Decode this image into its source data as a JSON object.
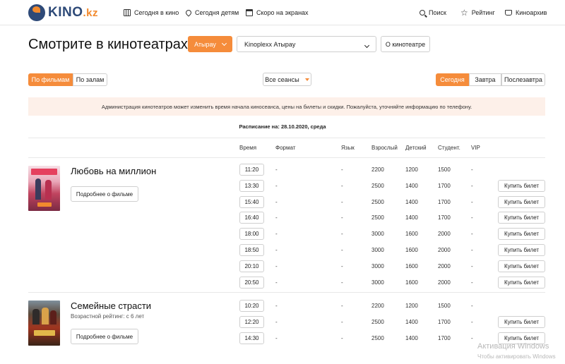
{
  "header": {
    "logo_main": "KINO",
    "logo_suffix": ".kz",
    "nav": [
      {
        "label": "Сегодня в кино",
        "icon": "film-icon"
      },
      {
        "label": "Сегодня детям",
        "icon": "location-pin-icon"
      },
      {
        "label": "Скоро на экранах",
        "icon": "calendar-icon"
      },
      {
        "label": "Поиск",
        "icon": "search-icon"
      },
      {
        "label": "Рейтинг",
        "icon": "star-icon"
      },
      {
        "label": "Киноархив",
        "icon": "archive-icon"
      }
    ]
  },
  "page": {
    "title": "Смотрите в кинотеатрах",
    "city": "Атырау",
    "cinema": "Kinoplexx Атырау",
    "about_cinema": "О кинотеатре"
  },
  "filters": {
    "by_movies": "По фильмам",
    "by_halls": "По залам",
    "sessions": "Все сеансы",
    "today": "Сегодня",
    "tomorrow": "Завтра",
    "day_after": "Послезавтра"
  },
  "notice": "Администрация кинотеатров может изменить время начала киносеанса, цены на билеты и скидки. Пожалуйста, уточняйте информацию по телефону.",
  "schedule_date": "Расписание на: 28.10.2020, среда",
  "columns": {
    "time": "Время",
    "format": "Формат",
    "language": "Язык",
    "adult": "Взрослый",
    "child": "Детский",
    "student": "Студент.",
    "vip": "VIP"
  },
  "movies": [
    {
      "title": "Любовь на миллион",
      "rating": "",
      "more": "Подробнее о фильме",
      "sessions": [
        {
          "time": "11:20",
          "format": "-",
          "lang": "-",
          "adult": "2200",
          "child": "1200",
          "student": "1500",
          "vip": "-",
          "buy": ""
        },
        {
          "time": "13:30",
          "format": "-",
          "lang": "-",
          "adult": "2500",
          "child": "1400",
          "student": "1700",
          "vip": "-",
          "buy": "Купить билет"
        },
        {
          "time": "15:40",
          "format": "-",
          "lang": "-",
          "adult": "2500",
          "child": "1400",
          "student": "1700",
          "vip": "-",
          "buy": "Купить билет"
        },
        {
          "time": "16:40",
          "format": "-",
          "lang": "-",
          "adult": "2500",
          "child": "1400",
          "student": "1700",
          "vip": "-",
          "buy": "Купить билет"
        },
        {
          "time": "18:00",
          "format": "-",
          "lang": "-",
          "adult": "3000",
          "child": "1600",
          "student": "2000",
          "vip": "-",
          "buy": "Купить билет"
        },
        {
          "time": "18:50",
          "format": "-",
          "lang": "-",
          "adult": "3000",
          "child": "1600",
          "student": "2000",
          "vip": "-",
          "buy": "Купить билет"
        },
        {
          "time": "20:10",
          "format": "-",
          "lang": "-",
          "adult": "3000",
          "child": "1600",
          "student": "2000",
          "vip": "-",
          "buy": "Купить билет"
        },
        {
          "time": "20:50",
          "format": "-",
          "lang": "-",
          "adult": "3000",
          "child": "1600",
          "student": "2000",
          "vip": "-",
          "buy": "Купить билет"
        }
      ]
    },
    {
      "title": "Семейные страсти",
      "rating": "Возрастной рейтинг: с 6 лет",
      "more": "Подробнее о фильме",
      "sessions": [
        {
          "time": "10:20",
          "format": "-",
          "lang": "-",
          "adult": "2200",
          "child": "1200",
          "student": "1500",
          "vip": "-",
          "buy": ""
        },
        {
          "time": "12:20",
          "format": "-",
          "lang": "-",
          "adult": "2500",
          "child": "1400",
          "student": "1700",
          "vip": "-",
          "buy": "Купить билет"
        },
        {
          "time": "14:30",
          "format": "-",
          "lang": "-",
          "adult": "2500",
          "child": "1400",
          "student": "1700",
          "vip": "-",
          "buy": "Купить билет"
        }
      ]
    }
  ],
  "os_watermark": {
    "line1": "Активация Windows",
    "line2": "Чтобы активировать Windows"
  }
}
